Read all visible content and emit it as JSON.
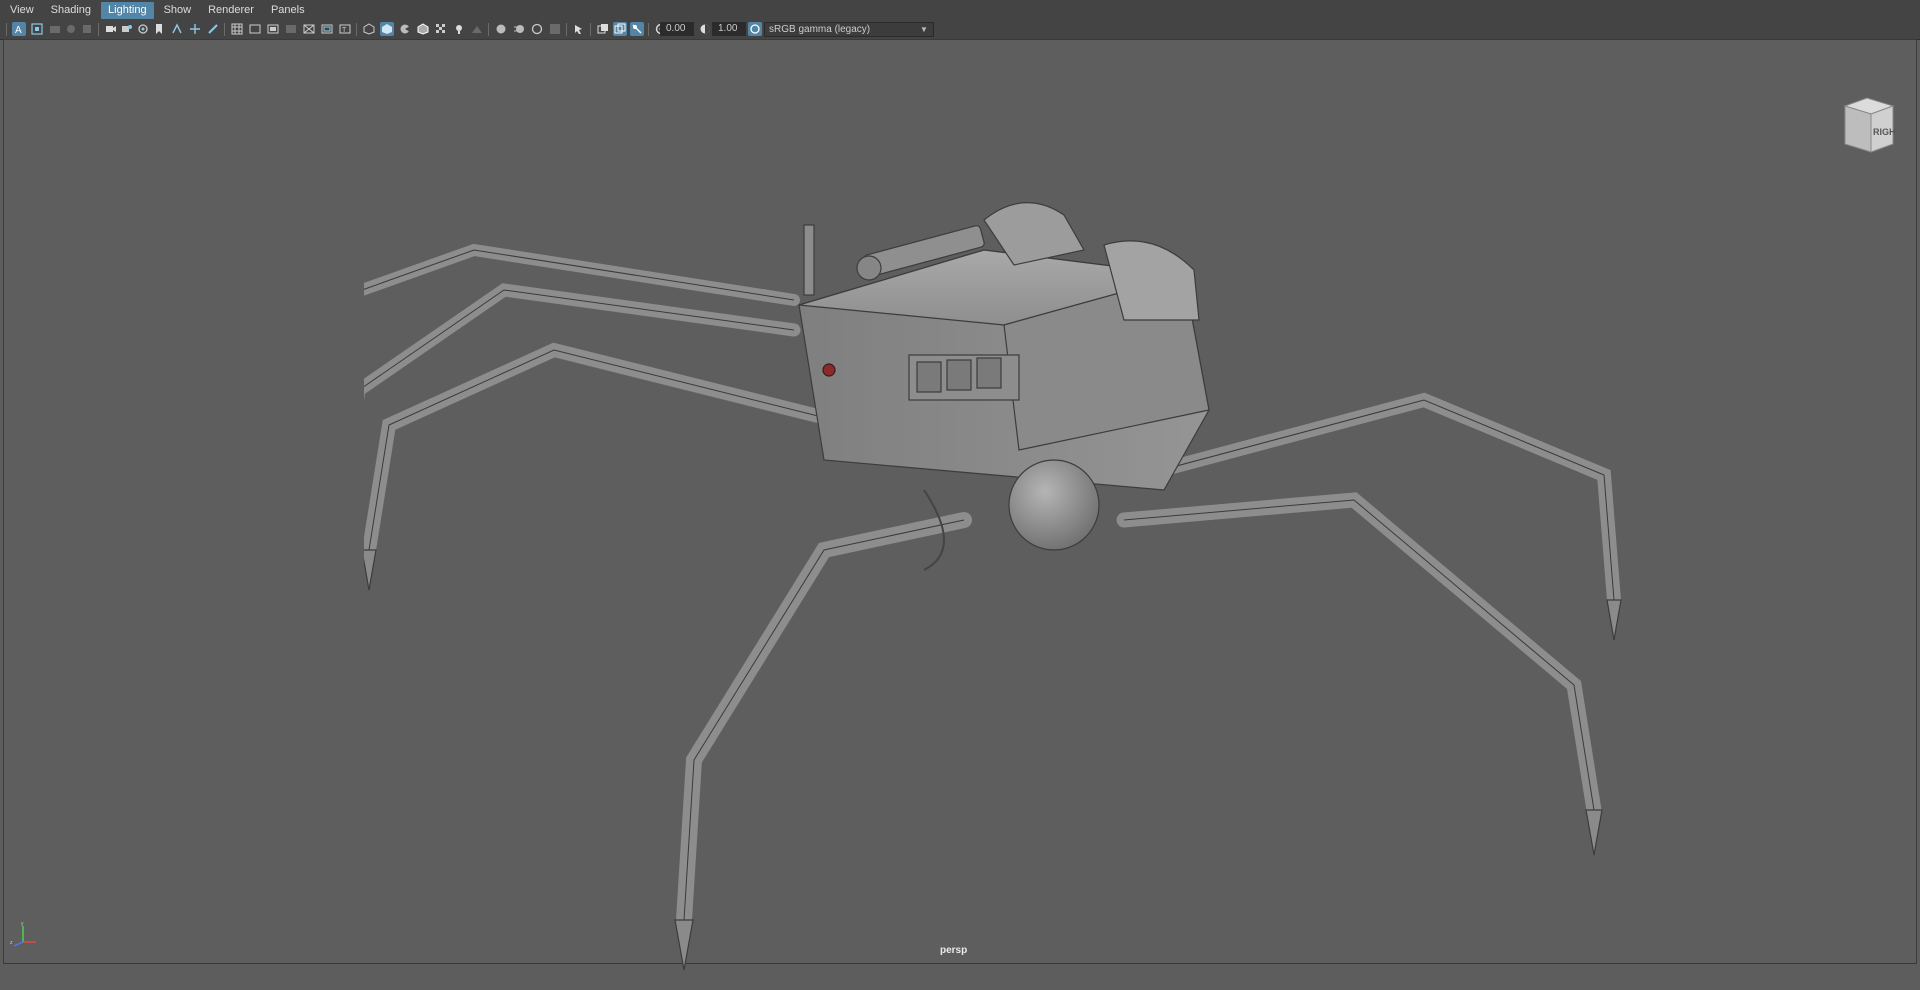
{
  "menus": [
    "View",
    "Shading",
    "Lighting",
    "Show",
    "Renderer",
    "Panels"
  ],
  "active_menu": "Lighting",
  "toolbar": {
    "exposure_value": "0.00",
    "gamma_value": "1.00",
    "color_space": "sRGB gamma (legacy)"
  },
  "viewcube": {
    "face_label": "RIGHT"
  },
  "viewport": {
    "camera_label": "persp"
  },
  "colors": {
    "accent": "#5285a6",
    "viewport_bg": "#5e5e5e",
    "panel_bg": "#444444"
  },
  "icons": [
    "select-camera-icon",
    "camera-attributes-icon",
    "bookmarks-icon",
    "image-plane-icon",
    "2d-pan-zoom-icon",
    "grease-pencil-icon",
    "grid-icon",
    "film-gate-icon",
    "resolution-gate-icon",
    "gate-mask-icon",
    "field-chart-icon",
    "safe-action-icon",
    "safe-title-icon",
    "wireframe-icon",
    "smooth-shade-icon",
    "default-material-icon",
    "wireframe-on-shaded-icon",
    "xray-icon",
    "use-all-lights-icon",
    "shadows-icon",
    "screen-space-ao-icon",
    "motion-blur-icon",
    "multisample-aa-icon",
    "depth-of-field-icon",
    "isolate-select-icon",
    "xray-joints-icon",
    "xray-active-icon",
    "backface-culling-icon",
    "exposure-icon",
    "gamma-icon",
    "color-management-icon"
  ]
}
